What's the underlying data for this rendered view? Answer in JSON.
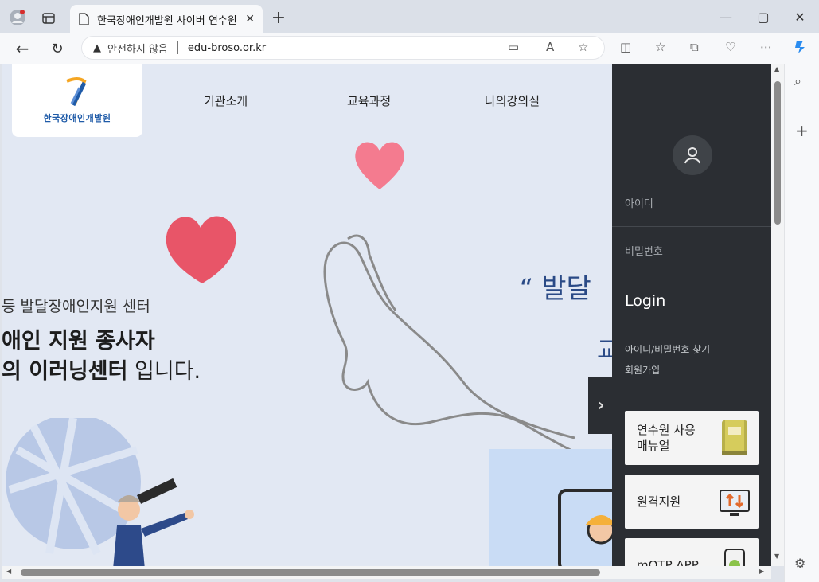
{
  "browser": {
    "tab_title": "한국장애인개발원 사이버 연수원",
    "address": {
      "security_label": "안전하지 않음",
      "url": "edu-broso.or.kr"
    }
  },
  "site": {
    "logo_text": "한국장애인개발원",
    "nav": [
      "기관소개",
      "교육과정",
      "나의강의실"
    ],
    "hero": {
      "subtitle": "등 발달장애인지원 센터",
      "line1": "애인 지원 종사자",
      "line2_bold": "의 이러닝센터",
      "line2_rest": " 입니다."
    },
    "quote": {
      "line1": "“ 발달",
      "line2": "교"
    }
  },
  "login_panel": {
    "id_label": "아이디",
    "password_label": "비밀번호",
    "login_button": "Login",
    "find_link": "아이디/비밀번호 찾기",
    "signup_link": "회원가입",
    "cards": [
      {
        "label": "연수원 사용\n매뉴얼",
        "icon": "book-icon"
      },
      {
        "label": "원격지원",
        "icon": "remote-monitor-icon"
      },
      {
        "label": "mOTP APP",
        "icon": "phone-shield-icon"
      }
    ]
  },
  "colors": {
    "page_bg": "#e2e8f3",
    "panel_bg": "#2b2e33",
    "heart_red": "#e85568",
    "heart_pink": "#f47b8f",
    "quote_blue": "#2a4a86"
  }
}
